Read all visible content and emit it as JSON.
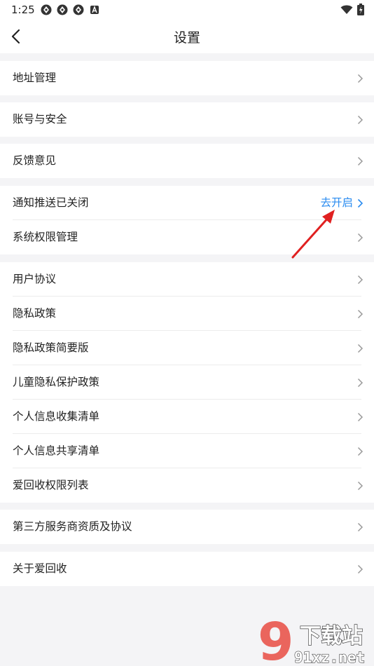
{
  "status_bar": {
    "time": "1:25",
    "icons": [
      "app-notification-icon",
      "app-notification-icon",
      "app-notification-icon",
      "a-notification-icon",
      "wifi-icon",
      "battery-charging-icon"
    ]
  },
  "header": {
    "title": "设置",
    "back_icon": "back-arrow-icon"
  },
  "groups": [
    {
      "items": [
        {
          "label": "地址管理"
        }
      ]
    },
    {
      "items": [
        {
          "label": "账号与安全"
        }
      ]
    },
    {
      "items": [
        {
          "label": "反馈意见"
        }
      ]
    },
    {
      "items": [
        {
          "label": "通知推送已关闭",
          "action": "去开启"
        },
        {
          "label": "系统权限管理"
        }
      ]
    },
    {
      "items": [
        {
          "label": "用户协议"
        },
        {
          "label": "隐私政策"
        },
        {
          "label": "隐私政策简要版"
        },
        {
          "label": "儿童隐私保护政策"
        },
        {
          "label": "个人信息收集清单"
        },
        {
          "label": "个人信息共享清单"
        },
        {
          "label": "爱回收权限列表"
        }
      ]
    },
    {
      "items": [
        {
          "label": "第三方服务商资质及协议"
        }
      ]
    },
    {
      "items": [
        {
          "label": "关于爱回收"
        }
      ]
    }
  ],
  "watermark": {
    "text": "下载站",
    "url": "91xz.net",
    "number": "9"
  },
  "colors": {
    "accent": "#2b8cf0",
    "annotation_arrow": "#e02020",
    "background": "#f4f4f6"
  }
}
